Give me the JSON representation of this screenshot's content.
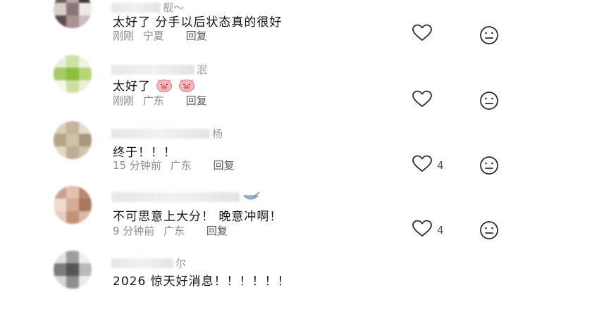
{
  "comments": [
    {
      "username_tail": "靓～",
      "content": "太好了 分手以后状态真的很好",
      "time": "刚刚",
      "location": "宁夏",
      "reply_label": "回复",
      "like_count": "",
      "avatar_colors": [
        "#6e5a58",
        "#b9a8a6",
        "#3e3536",
        "#d7cfcd",
        "#8b7676",
        "#efe9e8",
        "#5a4d4d",
        "#a99290",
        "#c9bebd"
      ]
    },
    {
      "username_tail": "泯",
      "content": "太好了",
      "emoji": "pig-face-emoji",
      "time": "刚刚",
      "location": "广东",
      "reply_label": "回复",
      "like_count": "",
      "avatar_colors": [
        "#e9f0d8",
        "#cfe1a7",
        "#eef3e2",
        "#a9c86a",
        "#8cbf3f",
        "#b8d47c",
        "#f5f8ee",
        "#cde0a3",
        "#e7efd6"
      ]
    },
    {
      "username_tail": "杨",
      "content": "终于！！！",
      "time": "15 分钟前",
      "location": "广东",
      "reply_label": "回复",
      "like_count": "4",
      "avatar_colors": [
        "#d8cdb9",
        "#c4b59c",
        "#e6dccb",
        "#b5a58a",
        "#cfc1a8",
        "#a8977d",
        "#e2d8c6",
        "#bfae93",
        "#d3c6ae"
      ]
    },
    {
      "username_tail": "",
      "content": "不可思意上大分！ 晚意冲啊！",
      "time": "9 分钟前",
      "location": "广东",
      "reply_label": "回复",
      "like_count": "4",
      "avatar_colors": [
        "#c9a08b",
        "#e3c2ad",
        "#b98a73",
        "#f0dccf",
        "#d4ac95",
        "#a87761",
        "#e8cdbd",
        "#c2937b",
        "#dbb8a3"
      ]
    },
    {
      "username_tail": "尔",
      "content": "2026 惊天好消息！！！！！！",
      "time": "",
      "location": "",
      "reply_label": "",
      "like_count": "",
      "avatar_colors": [
        "#e1e1e1",
        "#9e9e9e",
        "#f0f0f0",
        "#7d7d7d",
        "#555555",
        "#b9b9b9",
        "#d5d5d5",
        "#8f8f8f",
        "#ececec"
      ]
    }
  ]
}
